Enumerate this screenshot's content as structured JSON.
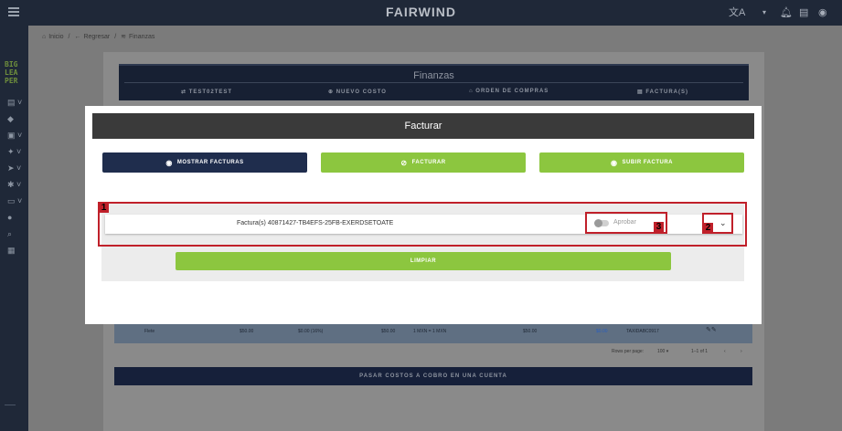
{
  "topbar": {
    "brand": "FAIRWIND",
    "icons": [
      "menu-icon",
      "translate-icon",
      "bell-icon",
      "chat-icon",
      "user-icon"
    ]
  },
  "sidebar": {
    "logo_lines": [
      "BIG",
      "LEA",
      "PER"
    ],
    "icons": [
      "document-icon",
      "tag-icon",
      "box-icon",
      "person-icon",
      "truck-icon",
      "gear-icon",
      "card-icon",
      "help-icon",
      "search-icon",
      "map-icon"
    ]
  },
  "breadcrumb": {
    "home": "Inicio",
    "back": "Regresar",
    "current": "Finanzas",
    "sep": "/"
  },
  "finanzas": {
    "title": "Finanzas",
    "tabs": [
      "TEST02TEST",
      "NUEVO COSTO",
      "ORDEN DE COMPRAS",
      "FACTURA(S)"
    ]
  },
  "table_row": {
    "cells": [
      "Flete",
      "$50.00",
      "$0.00 (16%)",
      "$50.00",
      "1 MXN = 1 MXN",
      "$50.00",
      "$0.00",
      "TAXIDABC0917"
    ]
  },
  "pager": {
    "rows_label": "Rows per page:",
    "rows_value": "100",
    "range": "1–1 of 1"
  },
  "pass_button": "PASAR COSTOS A COBRO EN UNA CUENTA",
  "modal": {
    "title": "Facturar",
    "buttons": {
      "show": "MOSTRAR FACTURAS",
      "invoice": "FACTURAR",
      "upload": "SUBIR FACTURA"
    },
    "item_text": "Factura(s) 40871427-TB4EFS-25FB-EXERDSETOATE",
    "toggle_label": "Aprobar",
    "toggle_on": false,
    "clear_button": "LIMPIAR"
  },
  "annotations": [
    "1",
    "2",
    "3"
  ],
  "colors": {
    "navy": "#1f2838",
    "green": "#8cc63f",
    "annotation_red": "#c0202a"
  }
}
